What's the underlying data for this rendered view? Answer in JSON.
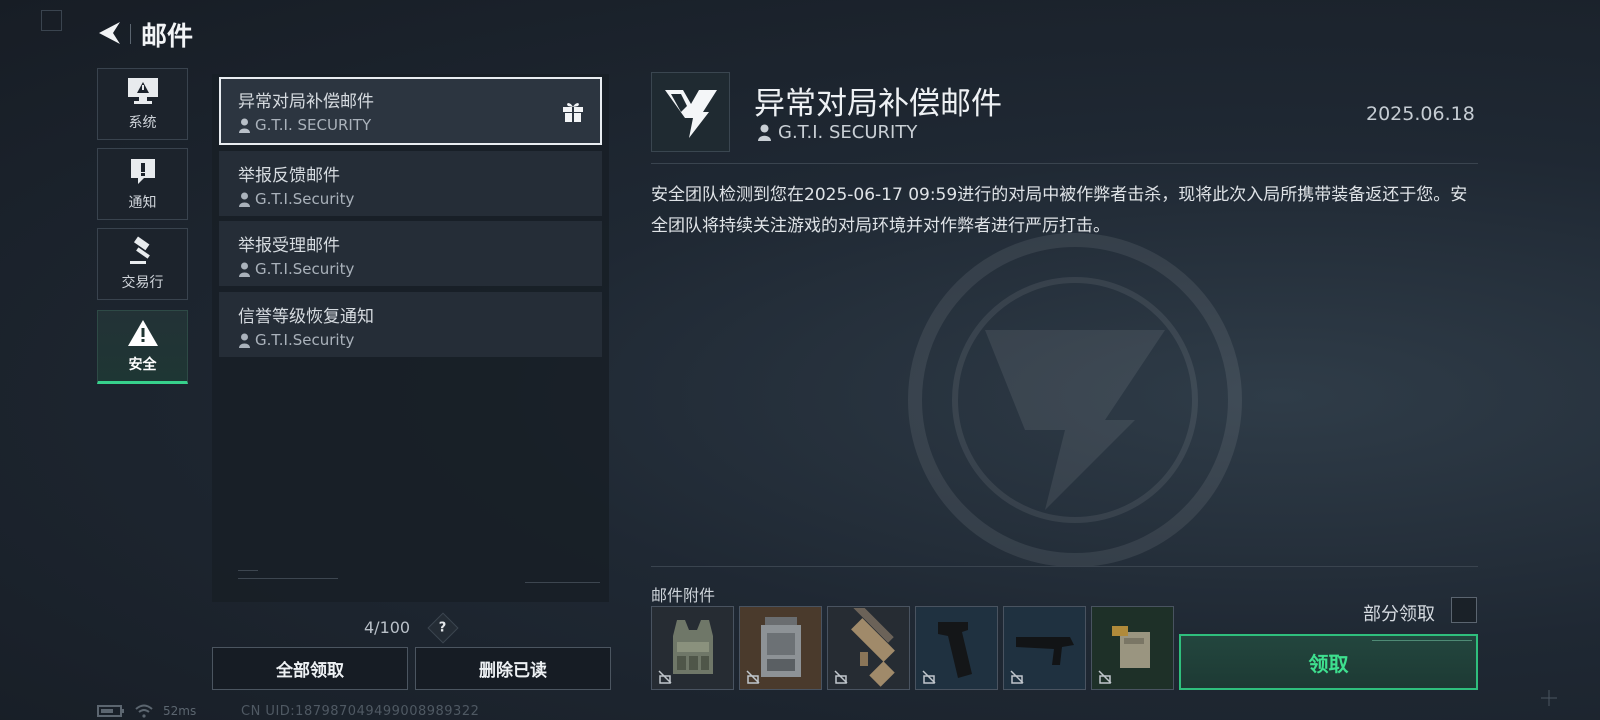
{
  "header": {
    "title": "邮件"
  },
  "nav": [
    {
      "label": "系统",
      "icon": "monitor-warning-icon",
      "active": false
    },
    {
      "label": "通知",
      "icon": "exclamation-icon",
      "active": false
    },
    {
      "label": "交易行",
      "icon": "gavel-icon",
      "active": false
    },
    {
      "label": "安全",
      "icon": "warning-triangle-icon",
      "active": true
    }
  ],
  "mails": [
    {
      "title": "异常对局补偿邮件",
      "sender": "G.T.I. SECURITY",
      "selected": true,
      "has_gift": true
    },
    {
      "title": "举报反馈邮件",
      "sender": "G.T.I.Security",
      "selected": false
    },
    {
      "title": "举报受理邮件",
      "sender": "G.T.I.Security",
      "selected": false
    },
    {
      "title": "信誉等级恢复通知",
      "sender": "G.T.I.Security",
      "selected": false
    }
  ],
  "list_footer": {
    "count": "4/100",
    "help": "?"
  },
  "buttons": {
    "claim_all": "全部领取",
    "delete_read": "删除已读"
  },
  "status": {
    "ping": "52ms",
    "uid": "CN UID:187987049499008989322"
  },
  "detail": {
    "title": "异常对局补偿邮件",
    "sender": "G.T.I. SECURITY",
    "date": "2025.06.18",
    "body": "安全团队检测到您在2025-06-17 09:59进行的对局中被作弊者击杀，现将此次入局所携带装备返还于您。安全团队将持续关注游戏的对局环境并对作弊者进行严厉打击。"
  },
  "attachments": {
    "label": "邮件附件",
    "items": [
      {
        "icon": "plate-carrier-vest-icon",
        "bg": "#262c33"
      },
      {
        "icon": "backpack-icon",
        "bg": "#4a3a2c"
      },
      {
        "icon": "rifle-icon",
        "bg": "#262c33"
      },
      {
        "icon": "pistol-grip-icon",
        "bg": "#1f3140"
      },
      {
        "icon": "rifle-stock-icon",
        "bg": "#1f3140"
      },
      {
        "icon": "ammo-box-icon",
        "bg": "#1e3028"
      }
    ]
  },
  "claim": {
    "partial_label": "部分领取",
    "claim_label": "领取"
  },
  "colors": {
    "accent_green": "#37d18c",
    "claim_text": "#3ee08f"
  }
}
